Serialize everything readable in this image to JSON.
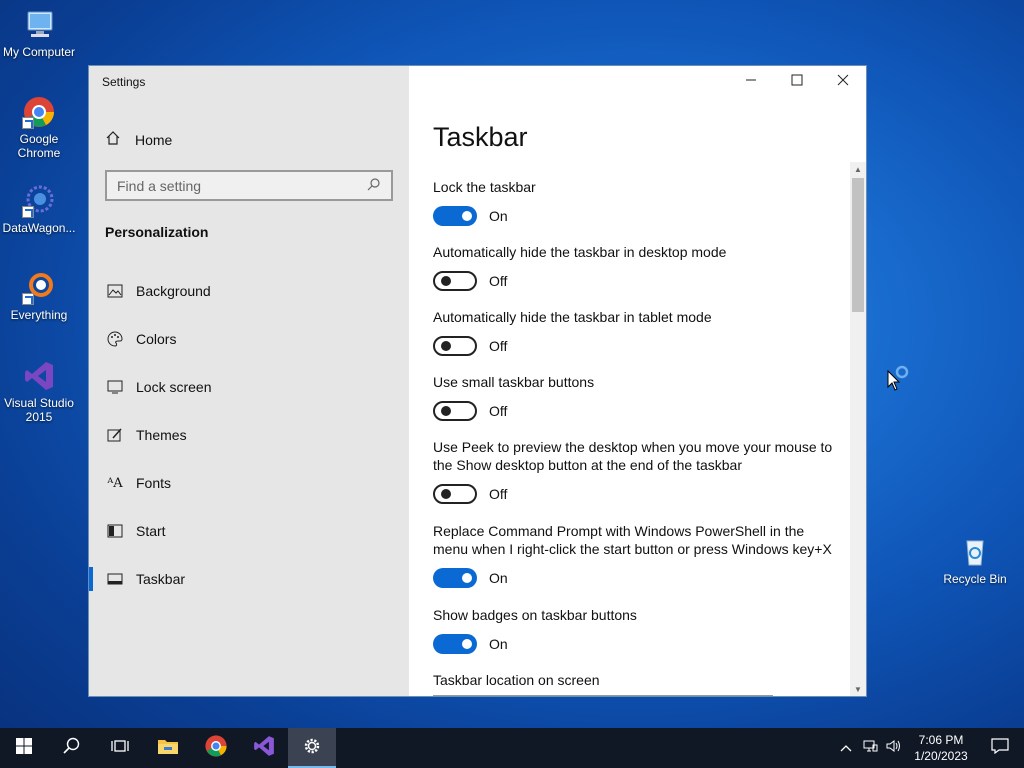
{
  "desktop": {
    "icons": [
      {
        "label": "My Computer",
        "icon": "computer-icon"
      },
      {
        "label": "Google Chrome",
        "icon": "chrome-icon"
      },
      {
        "label": "DataWagon...",
        "icon": "datawagon-icon"
      },
      {
        "label": "Everything",
        "icon": "everything-icon"
      },
      {
        "label": "Visual Studio 2015",
        "icon": "visual-studio-icon"
      },
      {
        "label": "Recycle Bin",
        "icon": "recycle-bin-icon"
      }
    ]
  },
  "window": {
    "title": "Settings",
    "controls": {
      "minimize": "minimize-icon",
      "maximize": "maximize-icon",
      "close": "close-icon"
    }
  },
  "sidebar": {
    "home_label": "Home",
    "search_placeholder": "Find a setting",
    "section": "Personalization",
    "items": [
      {
        "label": "Background",
        "icon": "picture-icon"
      },
      {
        "label": "Colors",
        "icon": "palette-icon"
      },
      {
        "label": "Lock screen",
        "icon": "lock-screen-icon"
      },
      {
        "label": "Themes",
        "icon": "themes-icon"
      },
      {
        "label": "Fonts",
        "icon": "fonts-icon"
      },
      {
        "label": "Start",
        "icon": "start-icon"
      },
      {
        "label": "Taskbar",
        "icon": "taskbar-icon",
        "active": true
      }
    ]
  },
  "main": {
    "title": "Taskbar",
    "settings": [
      {
        "label": "Lock the taskbar",
        "state": "On"
      },
      {
        "label": "Automatically hide the taskbar in desktop mode",
        "state": "Off"
      },
      {
        "label": "Automatically hide the taskbar in tablet mode",
        "state": "Off"
      },
      {
        "label": "Use small taskbar buttons",
        "state": "Off"
      },
      {
        "label": "Use Peek to preview the desktop when you move your mouse to the Show desktop button at the end of the taskbar",
        "state": "Off"
      },
      {
        "label": "Replace Command Prompt with Windows PowerShell in the menu when I right-click the start button or press Windows key+X",
        "state": "On"
      },
      {
        "label": "Show badges on taskbar buttons",
        "state": "On"
      }
    ],
    "location_label": "Taskbar location on screen"
  },
  "taskbar": {
    "clock_time": "7:06 PM",
    "clock_date": "1/20/2023",
    "apps": [
      "windows-start-icon",
      "search-icon",
      "task-view-icon",
      "file-explorer-icon",
      "chrome-icon",
      "visual-studio-icon",
      "settings-gear-icon"
    ]
  },
  "colors": {
    "accent": "#0a69d2",
    "taskbar": "#101826"
  }
}
